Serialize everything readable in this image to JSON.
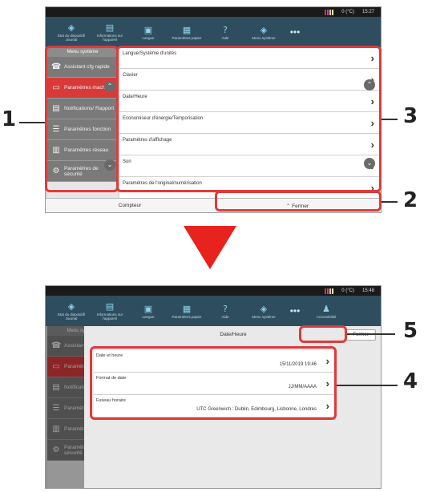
{
  "status": {
    "temp": "0 (°C)",
    "time1": "15:27",
    "time2": "15:48"
  },
  "toolbar1": [
    {
      "icon": "◈",
      "label": "Etat du dispositif/ Journal"
    },
    {
      "icon": "▤",
      "label": "Informations sur l'appareil"
    },
    {
      "icon": "▣",
      "label": "Langue"
    },
    {
      "icon": "▦",
      "label": "Paramètres papier"
    },
    {
      "icon": "?",
      "label": "Aide"
    },
    {
      "icon": "◈",
      "label": "Menu système"
    }
  ],
  "toolbar2": [
    {
      "icon": "◈",
      "label": "Etat du dispositif/ Journal"
    },
    {
      "icon": "▤",
      "label": "Informations sur l'appareil"
    },
    {
      "icon": "▣",
      "label": "Langue"
    },
    {
      "icon": "▦",
      "label": "Paramètres papier"
    },
    {
      "icon": "?",
      "label": "Aide"
    },
    {
      "icon": "◈",
      "label": "Menu système"
    },
    {
      "icon": "♟",
      "label": "Accessibilité"
    }
  ],
  "toolbar_more": "•••",
  "sidebar": {
    "header": "Menu système",
    "items": [
      {
        "icon": "☎",
        "label": "Assistant cfg rapide"
      },
      {
        "icon": "▭",
        "label": "Paramètres machine"
      },
      {
        "icon": "▤",
        "label": "Notifications/ Rapport"
      },
      {
        "icon": "☰",
        "label": "Paramètres fonction"
      },
      {
        "icon": "▥",
        "label": "Paramètres réseau"
      },
      {
        "icon": "⚙",
        "label": "Paramètres de sécurité"
      }
    ],
    "scroll_up": "⌃",
    "scroll_down": "⌄"
  },
  "list": [
    "Langue/Système d'unités",
    "Clavier",
    "Date/Heure",
    "Economiseur d'énergie/Temporisation",
    "Paramètres d'affichage",
    "Son",
    "Paramètres de l'original/numérisation"
  ],
  "chevron": "›",
  "bottom": {
    "left": "Compteur",
    "right": "Fermer",
    "right_icon": "⌃"
  },
  "dialog": {
    "title": "Date/Heure",
    "close": "Fermer",
    "rows": [
      {
        "label": "Date et heure",
        "value": "15/11/2019 19:46"
      },
      {
        "label": "Format de date",
        "value": "JJ/MM/AAAA"
      },
      {
        "label": "Fuseau horaire",
        "value": "UTC Greenwich : Dublin, Edimbourg, Lisbonne, Londres"
      }
    ]
  },
  "callouts": {
    "c1": "1",
    "c2": "2",
    "c3": "3",
    "c4": "4",
    "c5": "5"
  },
  "colors": {
    "accent": "#d83a3a",
    "toolbar": "#2e4d5f",
    "callout": "#e03a3a",
    "arrow": "#e8221c"
  }
}
